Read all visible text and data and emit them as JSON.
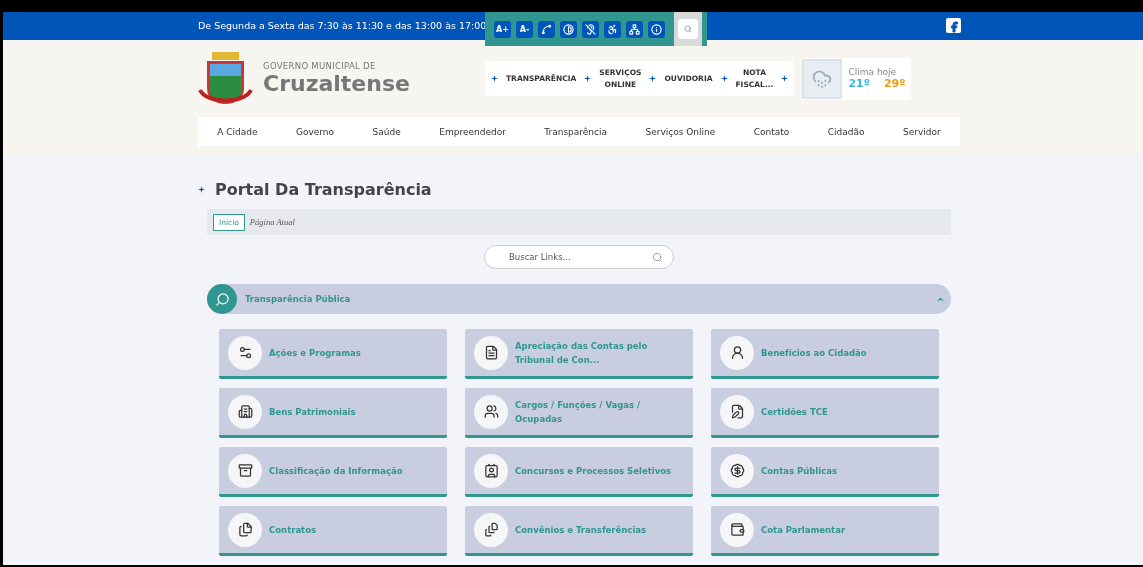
{
  "top_bar": {
    "hours": "De Segunda a Sexta das 7:30 às 11:30 e das 13:00 às 17:00",
    "font_buttons": [
      "A+",
      "A-"
    ]
  },
  "header": {
    "overline": "GOVERNO MUNICIPAL DE",
    "city": "Cruzaltense",
    "quick_links": [
      "TRANSPARÊNCIA",
      "SERVIÇOS ONLINE",
      "OUVIDORIA",
      "NOTA FISCAL..."
    ],
    "weather": {
      "title": "Clima hoje",
      "min": "21º",
      "max": "29º"
    }
  },
  "nav": [
    "A Cidade",
    "Governo",
    "Saúde",
    "Empreendedor",
    "Transparência",
    "Serviços Online",
    "Contato",
    "Cidadão",
    "Servidor"
  ],
  "page_title": "Portal Da Transparência",
  "breadcrumb": {
    "home": "Início",
    "current": "Página Atual"
  },
  "search": {
    "placeholder": "Buscar Links..."
  },
  "section": {
    "title": "Transparência Pública",
    "expanded": true
  },
  "cards": [
    {
      "label": "Ações e Programas"
    },
    {
      "label": "Apreciação das Contas pelo Tribunal de Con..."
    },
    {
      "label": "Benefícios ao Cidadão"
    },
    {
      "label": "Bens Patrimoniais"
    },
    {
      "label": "Cargos / Funções / Vagas / Ocupadas"
    },
    {
      "label": "Certidões TCE"
    },
    {
      "label": "Classificação da Informação"
    },
    {
      "label": "Concursos e Processos Seletivos"
    },
    {
      "label": "Contas Públicas"
    },
    {
      "label": "Contratos"
    },
    {
      "label": "Convênios e Transferências"
    },
    {
      "label": "Cota Parlamentar"
    }
  ]
}
